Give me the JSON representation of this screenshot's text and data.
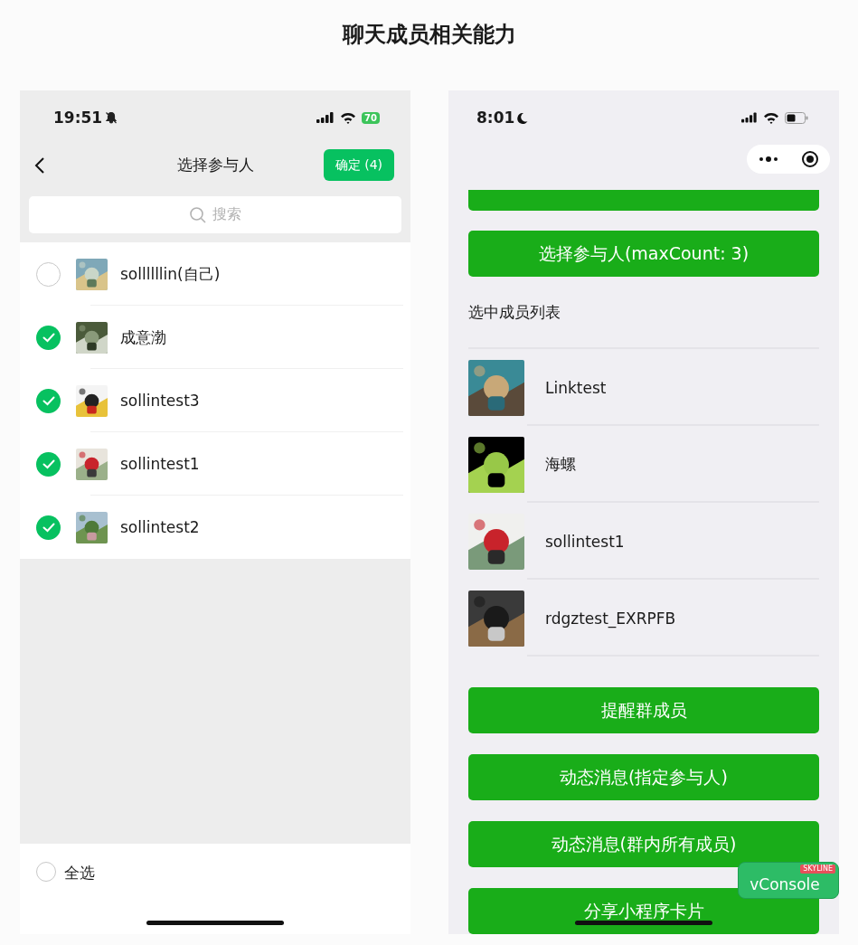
{
  "title": "聊天成员相关能力",
  "left_phone": {
    "status_bar": {
      "time": "19:51",
      "battery": "70"
    },
    "nav": {
      "title": "选择参与人",
      "confirm": "确定 (4)"
    },
    "search": {
      "placeholder": "搜索"
    },
    "members": [
      {
        "name": "sollllllin(自己)",
        "checked": false
      },
      {
        "name": "成意渤",
        "checked": true
      },
      {
        "name": "sollintest3",
        "checked": true
      },
      {
        "name": "sollintest1",
        "checked": true
      },
      {
        "name": "sollintest2",
        "checked": true
      }
    ],
    "select_all": {
      "label": "全选",
      "checked": false
    }
  },
  "right_phone": {
    "status_bar": {
      "time": "8:01"
    },
    "top_buttons": [
      "选择参与人(maxCount: 3)"
    ],
    "selected_heading": "选中成员列表",
    "selected_members": [
      {
        "name": "Linktest"
      },
      {
        "name": "海螺"
      },
      {
        "name": "sollintest1"
      },
      {
        "name": "rdgztest_EXRPFB"
      }
    ],
    "bottom_buttons": [
      "提醒群成员",
      "动态消息(指定参与人)",
      "动态消息(群内所有成员)",
      "分享小程序卡片"
    ],
    "vconsole": {
      "label": "vConsole",
      "ribbon": "SKYLINE"
    }
  }
}
